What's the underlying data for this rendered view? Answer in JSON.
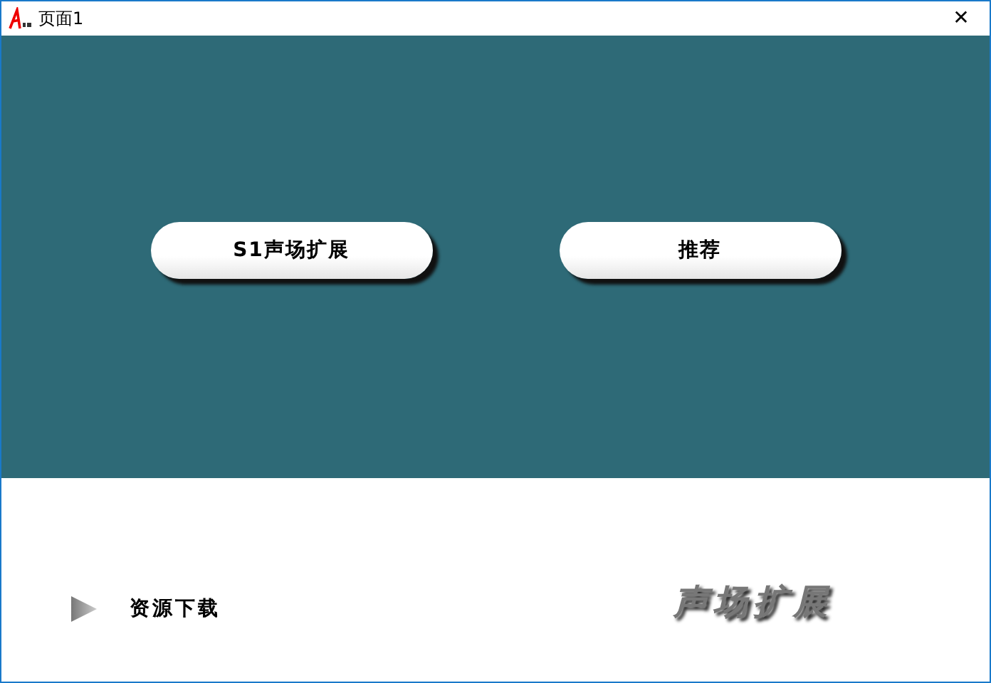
{
  "window": {
    "title": "页面1",
    "close": "✕"
  },
  "buttons": [
    {
      "label": "S1声场扩展"
    },
    {
      "label": "推荐"
    }
  ],
  "download": {
    "label": "资源下载"
  },
  "logo_text": "声场扩展"
}
